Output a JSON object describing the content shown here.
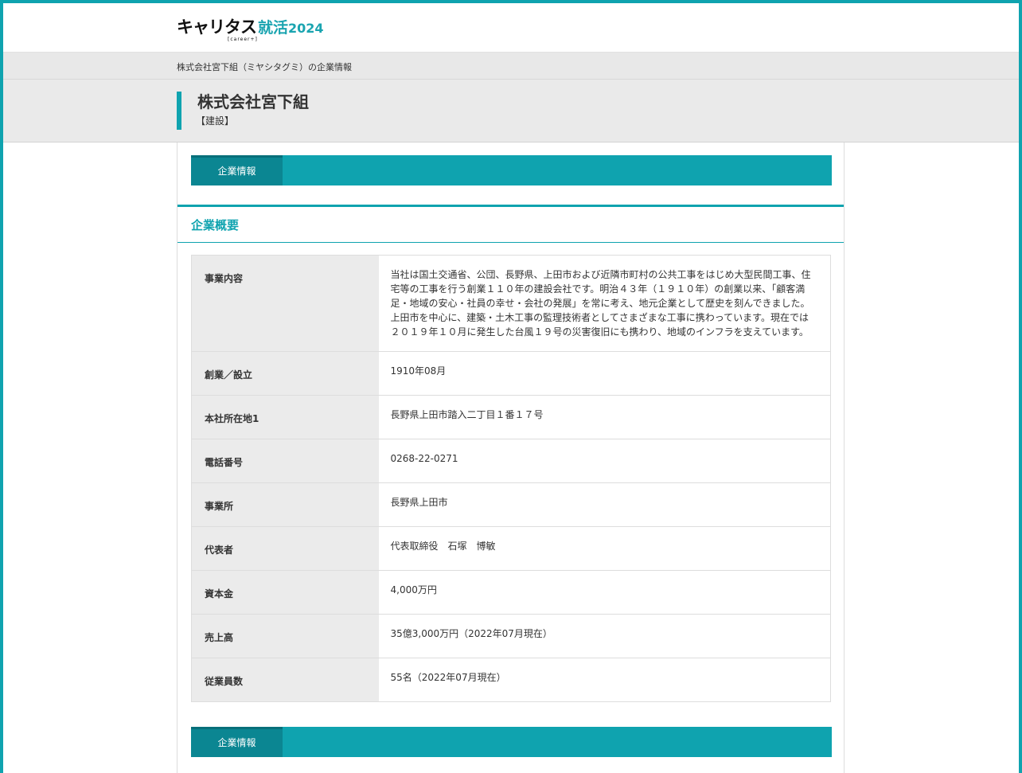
{
  "logo": {
    "main": "キャリタス",
    "accent": "就活",
    "year": "2024",
    "sub": "[career+]"
  },
  "breadcrumb": "株式会社宮下組（ミヤシタグミ）の企業情報",
  "company": {
    "name": "株式会社宮下組",
    "industry": "【建設】"
  },
  "tabs": {
    "top_label": "企業情報",
    "bottom_label": "企業情報"
  },
  "section": {
    "title": "企業概要"
  },
  "rows": [
    {
      "label": "事業内容",
      "value": "当社は国土交通省、公団、長野県、上田市および近隣市町村の公共工事をはじめ大型民間工事、住宅等の工事を行う創業１１０年の建設会社です。明治４３年（１９１０年）の創業以来、「顧客満足・地域の安心・社員の幸せ・会社の発展」を常に考え、地元企業として歴史を刻んできました。上田市を中心に、建築・土木工事の監理技術者としてさまざまな工事に携わっています。現在では２０１９年１０月に発生した台風１９号の災害復旧にも携わり、地域のインフラを支えています。"
    },
    {
      "label": "創業／設立",
      "value": "1910年08月"
    },
    {
      "label": "本社所在地1",
      "value": "長野県上田市踏入二丁目１番１７号"
    },
    {
      "label": "電話番号",
      "value": "0268-22-0271"
    },
    {
      "label": "事業所",
      "value": "長野県上田市"
    },
    {
      "label": "代表者",
      "value": "代表取締役　石塚　博敏"
    },
    {
      "label": "資本金",
      "value": "4,000万円"
    },
    {
      "label": "売上高",
      "value": "35億3,000万円（2022年07月現在）"
    },
    {
      "label": "従業員数",
      "value": "55名（2022年07月現在）"
    }
  ],
  "colors": {
    "accent": "#0fa3af",
    "tab_active": "#0b8692",
    "label_bg": "#ebebeb"
  }
}
